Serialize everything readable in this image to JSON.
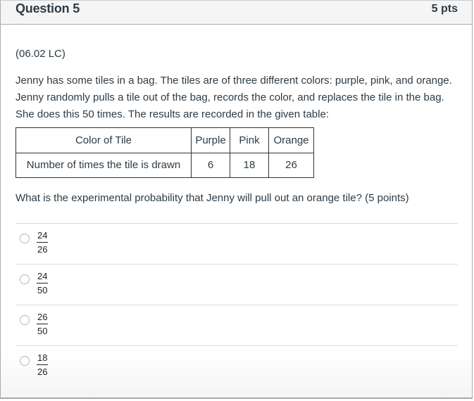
{
  "header": {
    "title": "Question 5",
    "points": "5 pts"
  },
  "question": {
    "code": "(06.02 LC)",
    "stem": "Jenny has some tiles in a bag. The tiles are of three different colors: purple, pink, and orange. Jenny randomly pulls a tile out of the bag, records the color, and replaces the tile in the bag. She does this 50 times. The results are recorded in the given table:",
    "table": {
      "header_row": [
        "Color of Tile",
        "Purple",
        "Pink",
        "Orange"
      ],
      "data_row": [
        "Number of times the tile is drawn",
        "6",
        "18",
        "26"
      ]
    },
    "prompt": "What is the experimental probability that Jenny will pull out an orange tile? (5 points)"
  },
  "answers": [
    {
      "numerator": "24",
      "denominator": "26"
    },
    {
      "numerator": "24",
      "denominator": "50"
    },
    {
      "numerator": "26",
      "denominator": "50"
    },
    {
      "numerator": "18",
      "denominator": "26"
    }
  ]
}
